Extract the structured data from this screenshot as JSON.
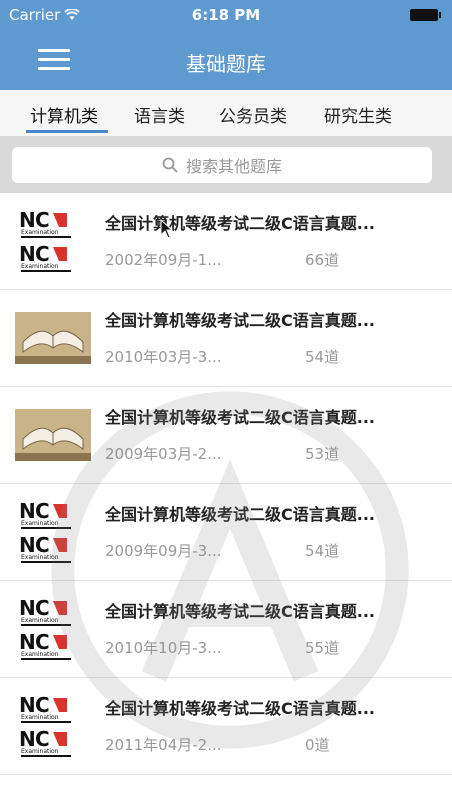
{
  "status": {
    "carrier": "Carrier",
    "time": "6:18 PM"
  },
  "navbar": {
    "title": "基础题库"
  },
  "tabs": [
    {
      "label": "计算机类"
    },
    {
      "label": "语言类"
    },
    {
      "label": "公务员类"
    },
    {
      "label": "研究生类"
    }
  ],
  "search": {
    "placeholder": "搜索其他题库"
  },
  "items": [
    {
      "thumb": "ncre-logo",
      "title": "全国计算机等级考试二级C语言真题...",
      "date": "2002年09月-1...",
      "count": "66道"
    },
    {
      "thumb": "book-image",
      "title": "全国计算机等级考试二级C语言真题...",
      "date": "2010年03月-3...",
      "count": "54道"
    },
    {
      "thumb": "book-image",
      "title": "全国计算机等级考试二级C语言真题...",
      "date": "2009年03月-2...",
      "count": "53道"
    },
    {
      "thumb": "ncre-logo",
      "title": "全国计算机等级考试二级C语言真题...",
      "date": "2009年09月-3...",
      "count": "54道"
    },
    {
      "thumb": "ncre-logo",
      "title": "全国计算机等级考试二级C语言真题...",
      "date": "2010年10月-3...",
      "count": "55道"
    },
    {
      "thumb": "ncre-logo",
      "title": "全国计算机等级考试二级C语言真题...",
      "date": "2011年04月-2...",
      "count": "0道"
    }
  ],
  "colors": {
    "nav": "#5e9ad0",
    "accent": "#4a89c8"
  }
}
